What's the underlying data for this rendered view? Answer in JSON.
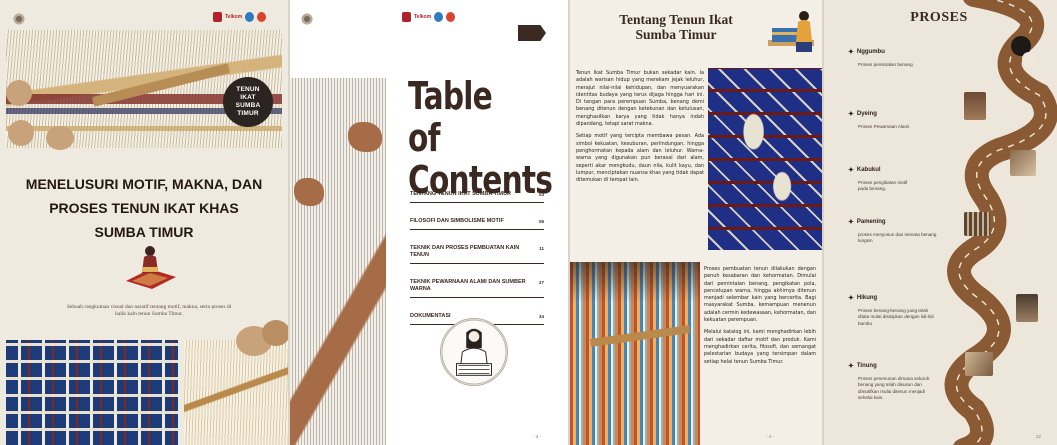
{
  "cover": {
    "badge_lines": [
      "TENUN",
      "IKAT",
      "SUMBA",
      "TIMUR"
    ],
    "title_lines": [
      "MENELUSURI MOTIF, MAKNA, DAN",
      "PROSES TENUN IKAT KHAS",
      "SUMBA TIMUR"
    ],
    "subtitle": "Sebuah rangkuman visual dan naratif tentang motif, makna, serta proses di balik kain tenun Sumba Timur.",
    "partner_text": "Telkom"
  },
  "toc": {
    "heading_lines": [
      "Table of",
      "Contents"
    ],
    "items": [
      {
        "label": "TENTANG TENUN IKAT SUMBA TIMUR",
        "page": "03"
      },
      {
        "label": "FILOSOFI DAN SIMBOLISME MOTIF",
        "page": "06"
      },
      {
        "label": "TEKNIK DAN PROSES PEMBUATAN KAIN TENUN",
        "page": "11"
      },
      {
        "label": "TEKNIK PEWARNAAN ALAMI DAN SUMBER WARNA",
        "page": "27"
      },
      {
        "label": "DOKUMENTASI",
        "page": "34"
      }
    ],
    "page_number": "- 3 -"
  },
  "about": {
    "title_lines": [
      "Tentang Tenun Ikat",
      "Sumba Timur"
    ],
    "intro_paragraphs": [
      "Tenun Ikat Sumba Timur bukan sekadar kain. Ia adalah warisan hidup yang merekam jejak leluhur, merajut nilai-nilai kehidupan, dan menyuarakan identitas budaya yang terus dijaga hingga hari ini. Di tangan para perempuan Sumba, benang demi benang ditenun dengan ketekunan dan ketulusan, menghasilkan karya yang tidak hanya indah dipandang, tetapi sarat makna.",
      "Setiap motif yang tercipta membawa pesan. Ada simbol kekuatan, kesuburan, perlindungan, hingga penghormatan kepada alam dan leluhur. Warna-warna yang digunakan pun berasal dari alam, seperti akar mengkudu, daun nila, kulit kayu, dan lumpur, menciptakan nuansa khas yang tidak dapat ditemukan di tempat lain."
    ],
    "process_paragraphs": [
      "Proses pembuatan tenun dilakukan dengan penuh kesabaran dan kehormatan. Dimulai dari pemintalan benang, pengikatan pola, pencelupan warna, hingga akhirnya ditenun menjadi selembar kain yang bercerita. Bagi masyarakat Sumba, kemampuan menenun adalah cermin kedewasaan, kehormatan, dan kekuatan perempuan.",
      "Melalui katalog ini, kami menghadirkan lebih dari sekadar daftar motif dan produk. Kami menghadirkan cerita, filosofi, dan semangat pelestarian budaya yang tersimpan dalam setiap helai tenun Sumba Timur."
    ],
    "page_number": "- 4 -"
  },
  "process": {
    "title": "PROSES",
    "steps": [
      {
        "name": "Nggumbu",
        "desc": "Proses pemintalan benang"
      },
      {
        "name": "Dyeing",
        "desc": "Proses Pewarnaan Alami"
      },
      {
        "name": "Kabukul",
        "desc": "Proses pengikatan motif pada benang."
      },
      {
        "name": "Pamening",
        "desc": "proses menyusun dan menata benang lungsin"
      },
      {
        "name": "Hikung",
        "desc": "Proses benang-benang yang telah ditata mulai disisipkan dengan lidi-lidi bambu"
      },
      {
        "name": "Tinung",
        "desc": "Proses penenunan dimana seluruh benang yang telah disusun dan dimotifkan mulai ditenun menjadi sehelai kain."
      }
    ],
    "page_number": "22"
  },
  "colors": {
    "dark_brown": "#3b2820",
    "ikat_blue": "#1f2f86",
    "road": "#8a5a34"
  }
}
